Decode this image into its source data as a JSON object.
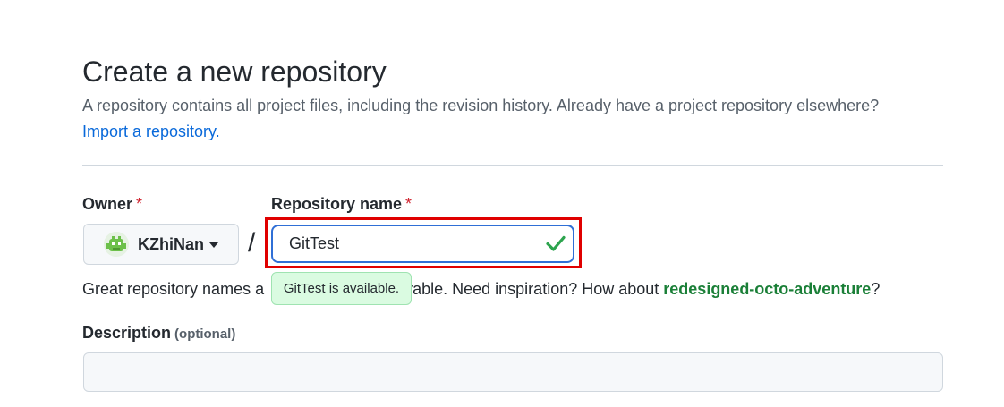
{
  "header": {
    "title": "Create a new repository",
    "subtitle": "A repository contains all project files, including the revision history. Already have a project repository elsewhere?",
    "import_link": "Import a repository."
  },
  "owner": {
    "label": "Owner",
    "required_mark": "*",
    "value": "KZhiNan",
    "avatar_icon": "robot-avatar-icon",
    "dropdown_icon": "caret-down-icon"
  },
  "separator": "/",
  "repository": {
    "label": "Repository name",
    "required_mark": "*",
    "value": "GitTest",
    "status_icon": "check-icon",
    "status_color": "#2da44e",
    "tooltip": "GitTest is available."
  },
  "helper": {
    "prefix": "Great repository names a",
    "middle": "orable. Need inspiration? How about ",
    "suggestion": "redesigned-octo-adventure",
    "suffix": "?"
  },
  "description": {
    "label": "Description",
    "optional": "(optional)",
    "value": ""
  },
  "colors": {
    "link": "#0969da",
    "suggestion": "#1a7f37",
    "highlight_box": "#e00000",
    "tooltip_bg": "#dafbe1"
  }
}
